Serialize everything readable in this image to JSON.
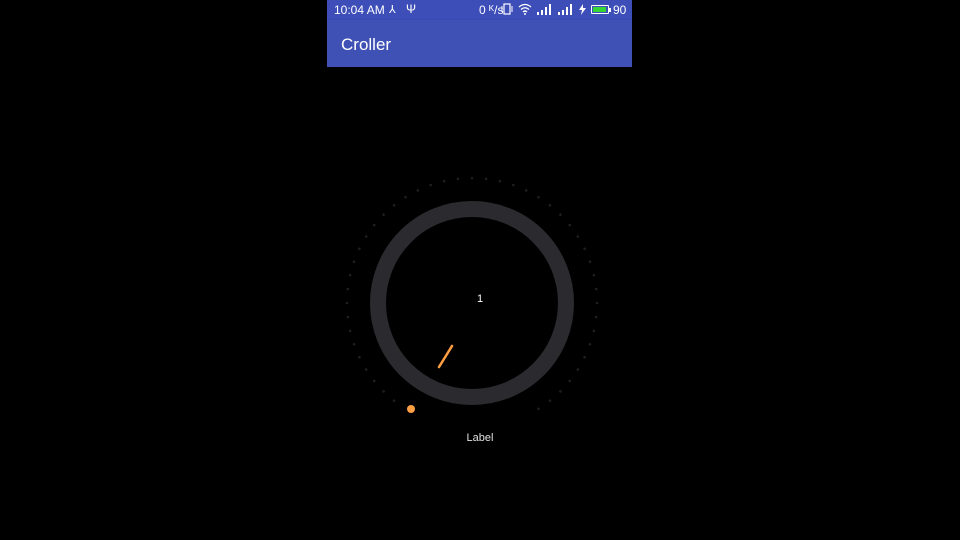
{
  "status_bar": {
    "time": "10:04 AM",
    "usb_icon": "usb-icon",
    "net_speed": "0 ᴷ/s",
    "battery_percent": "90",
    "battery_level": 0.9,
    "icons": [
      "vibrate-icon",
      "wifi-icon",
      "signal-icon",
      "signal-icon",
      "charging-icon"
    ]
  },
  "app_bar": {
    "title": "Croller",
    "color": "#3f51b5"
  },
  "croller": {
    "value": "1",
    "label": "Label",
    "progress_color": "#ff9f43",
    "ring_color": "#2b2a2e",
    "dot_color": "#1f1f1f"
  }
}
